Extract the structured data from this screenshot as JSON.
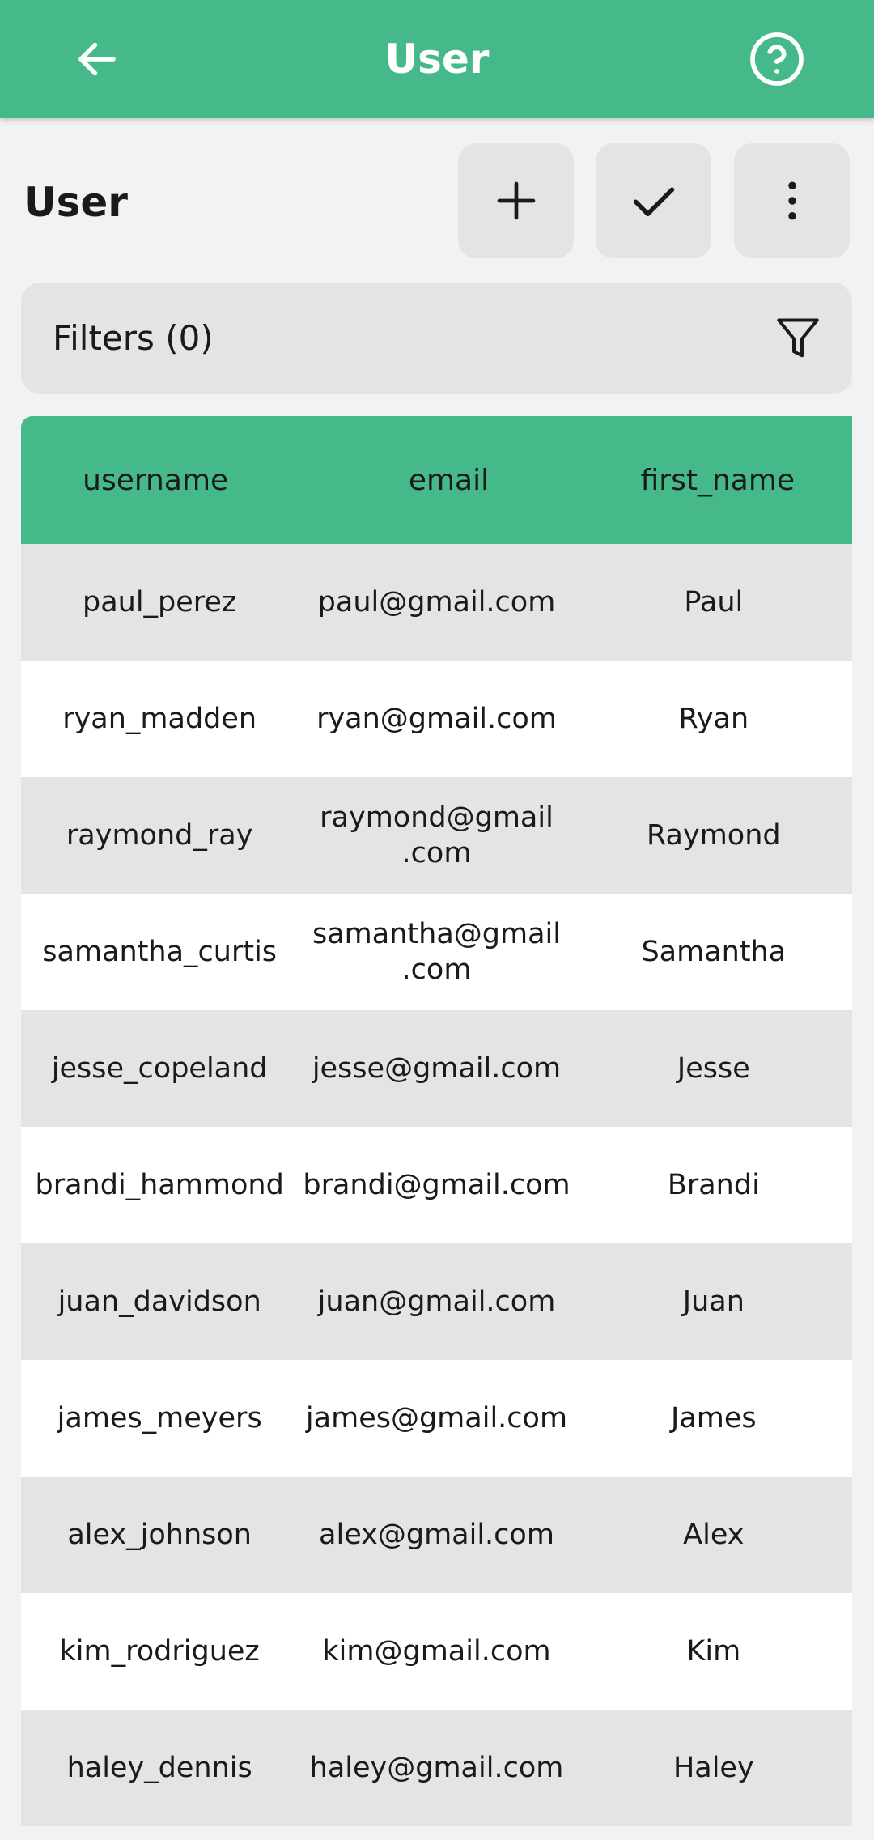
{
  "appbar": {
    "title": "User",
    "back_icon": "arrow-left-icon",
    "help_icon": "help-circle-icon"
  },
  "toolbar": {
    "title": "User",
    "buttons": [
      {
        "icon": "plus-icon"
      },
      {
        "icon": "check-icon"
      },
      {
        "icon": "more-vertical-icon"
      }
    ]
  },
  "filters": {
    "label": "Filters (0)",
    "icon": "filter-icon"
  },
  "table": {
    "columns": [
      "username",
      "email",
      "first_name"
    ],
    "rows": [
      {
        "username": "paul_perez",
        "email": "paul@gmail.com",
        "first_name": "Paul"
      },
      {
        "username": "ryan_madden",
        "email": "ryan@gmail.com",
        "first_name": "Ryan"
      },
      {
        "username": "raymond_ray",
        "email": "raymond@gmail\n.com",
        "first_name": "Raymond"
      },
      {
        "username": "samantha_curtis",
        "email": "samantha@gmail\n.com",
        "first_name": "Samantha"
      },
      {
        "username": "jesse_copeland",
        "email": "jesse@gmail.com",
        "first_name": "Jesse"
      },
      {
        "username": "brandi_hammond",
        "email": "brandi@gmail.com",
        "first_name": "Brandi"
      },
      {
        "username": "juan_davidson",
        "email": "juan@gmail.com",
        "first_name": "Juan"
      },
      {
        "username": "james_meyers",
        "email": "james@gmail.com",
        "first_name": "James"
      },
      {
        "username": "alex_johnson",
        "email": "alex@gmail.com",
        "first_name": "Alex"
      },
      {
        "username": "kim_rodriguez",
        "email": "kim@gmail.com",
        "first_name": "Kim"
      },
      {
        "username": "haley_dennis",
        "email": "haley@gmail.com",
        "first_name": "Haley"
      }
    ]
  },
  "colors": {
    "accent": "#46b98b",
    "row_alt": "#e4e4e4",
    "background": "#f2f2f2"
  }
}
